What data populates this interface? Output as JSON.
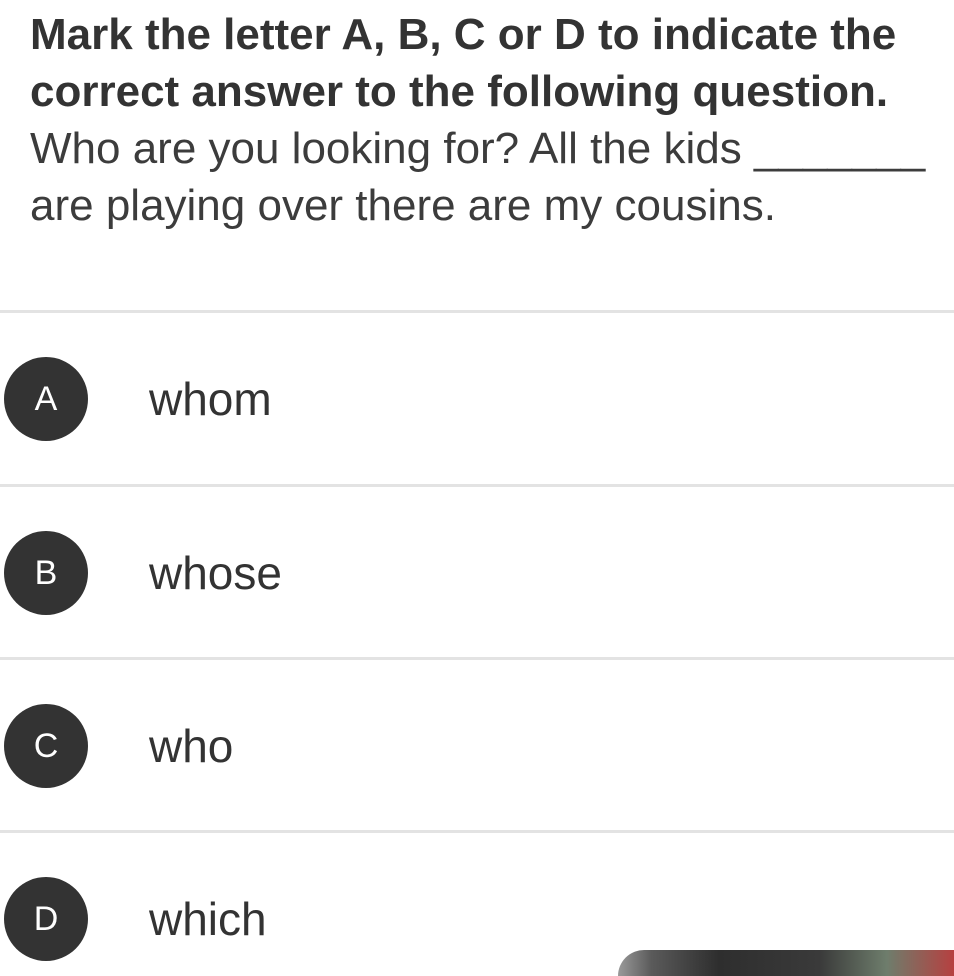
{
  "question": {
    "instruction": "Mark the letter A, B, C or D to indicate the correct answer to the following question.",
    "stem": "Who are you looking for? All the kids _______ are playing over there are my cousins."
  },
  "options": [
    {
      "letter": "A",
      "text": "whom"
    },
    {
      "letter": "B",
      "text": "whose"
    },
    {
      "letter": "C",
      "text": "who"
    },
    {
      "letter": "D",
      "text": "which"
    }
  ]
}
